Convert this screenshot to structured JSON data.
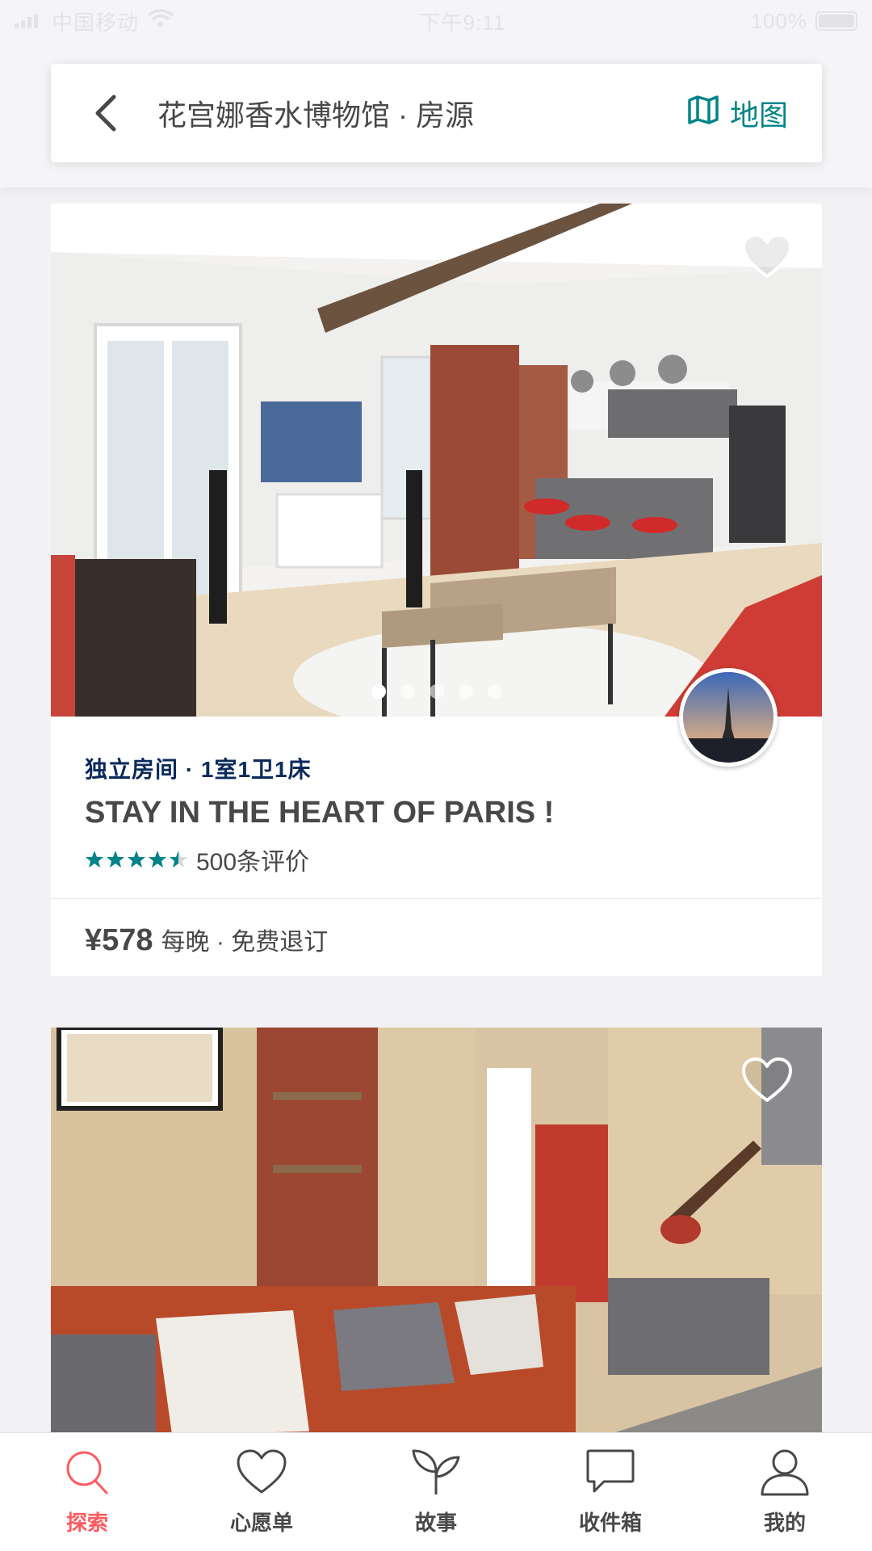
{
  "status_bar": {
    "carrier": "中国移动",
    "time": "下午9:11",
    "battery": "100%"
  },
  "header": {
    "title": "花宫娜香水博物馆 · 房源",
    "map_label": "地图"
  },
  "listings": [
    {
      "room_type": "独立房间 · 1室1卫1床",
      "title": "STAY IN THE HEART OF PARIS !",
      "rating": 4.5,
      "reviews": "500条评价",
      "price": "¥578",
      "price_note": "每晚 · 免费退订",
      "photo_count": 5,
      "active_photo": 0
    },
    {
      "room_type": "",
      "title": ""
    }
  ],
  "tab_bar": {
    "active": "explore",
    "tabs": [
      {
        "id": "explore",
        "label": "探索",
        "icon": "search-icon"
      },
      {
        "id": "wishlist",
        "label": "心愿单",
        "icon": "heart-icon"
      },
      {
        "id": "stories",
        "label": "故事",
        "icon": "sprout-icon"
      },
      {
        "id": "inbox",
        "label": "收件箱",
        "icon": "chat-bubble-icon"
      },
      {
        "id": "profile",
        "label": "我的",
        "icon": "person-icon"
      }
    ]
  },
  "colors": {
    "accent": "#008489",
    "brand": "#ff5a5f",
    "text": "#484848",
    "room_type": "#0b2a5b"
  }
}
